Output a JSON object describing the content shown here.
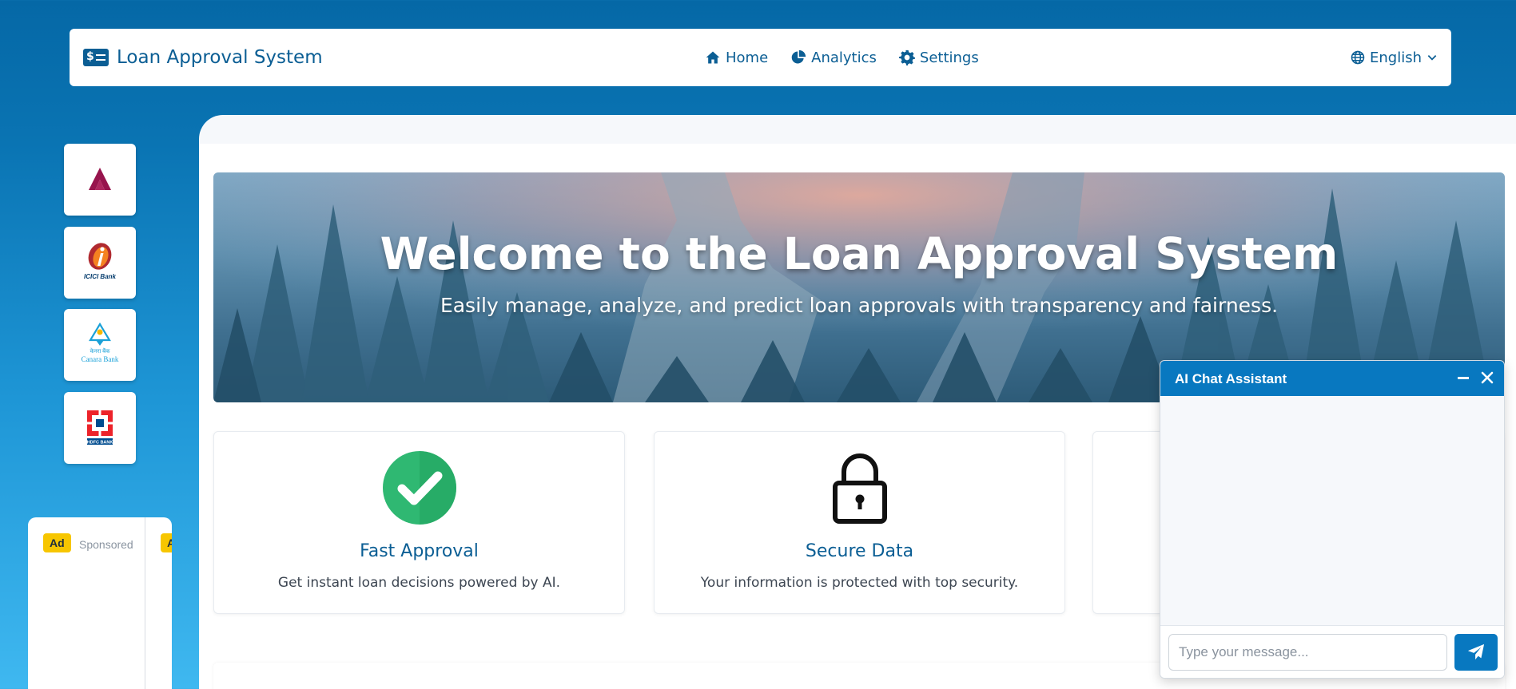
{
  "navbar": {
    "brand_title": "Loan Approval System",
    "brand_icon": "money-bill-icon",
    "links": [
      {
        "label": "Home",
        "icon": "home-icon"
      },
      {
        "label": "Analytics",
        "icon": "chart-pie-icon"
      },
      {
        "label": "Settings",
        "icon": "gear-icon"
      }
    ],
    "language": "English"
  },
  "sidebar": {
    "banks": [
      {
        "name": "Axis Bank",
        "logo": "axis-bank-logo"
      },
      {
        "name": "ICICI Bank",
        "logo": "icici-bank-logo",
        "logo_text": "ICICI Bank"
      },
      {
        "name": "Canara Bank",
        "logo": "canara-bank-logo",
        "logo_text": "Canara Bank"
      },
      {
        "name": "HDFC Bank",
        "logo": "hdfc-bank-logo",
        "logo_text": "HDFC BANK"
      }
    ]
  },
  "ad": {
    "badge": "Ad",
    "sponsored": "Sponsored"
  },
  "hero": {
    "title": "Welcome to the Loan Approval System",
    "subtitle": "Easily manage, analyze, and predict loan approvals with transparency and fairness."
  },
  "features": [
    {
      "title": "Fast Approval",
      "description": "Get instant loan decisions powered by AI.",
      "icon": "check-circle-icon"
    },
    {
      "title": "Secure Data",
      "description": "Your information is protected with top security.",
      "icon": "lock-icon"
    }
  ],
  "chat": {
    "title": "AI Chat Assistant",
    "input_placeholder": "Type your message...",
    "send_icon": "paper-plane-icon"
  },
  "colors": {
    "primary": "#0b5e94",
    "chat_header": "#0878c0",
    "success": "#2fb872",
    "ad_badge": "#f7c600"
  }
}
